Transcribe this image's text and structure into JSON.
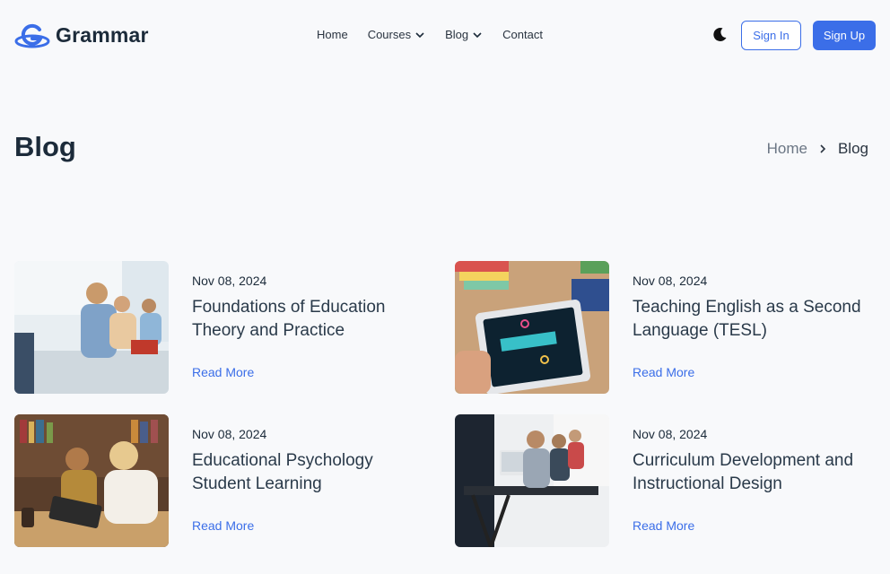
{
  "brand": {
    "name": "Grammar",
    "accent": "#3b6ee8"
  },
  "nav": {
    "items": [
      {
        "label": "Home",
        "has_dropdown": false
      },
      {
        "label": "Courses",
        "has_dropdown": true
      },
      {
        "label": "Blog",
        "has_dropdown": true
      },
      {
        "label": "Contact",
        "has_dropdown": false
      }
    ]
  },
  "header": {
    "theme_icon": "moon-icon",
    "signin_label": "Sign In",
    "signup_label": "Sign Up"
  },
  "page": {
    "title": "Blog",
    "breadcrumb": {
      "home": "Home",
      "current": "Blog"
    }
  },
  "posts": [
    {
      "date": "Nov 08, 2024",
      "title": "Foundations of Education Theory and Practice",
      "read_more": "Read More"
    },
    {
      "date": "Nov 08, 2024",
      "title": "Teaching English as a Second Language (TESL)",
      "read_more": "Read More"
    },
    {
      "date": "Nov 08, 2024",
      "title": "Educational Psychology Student Learning",
      "read_more": "Read More"
    },
    {
      "date": "Nov 08, 2024",
      "title": "Curriculum Development and Instructional Design",
      "read_more": "Read More"
    }
  ]
}
